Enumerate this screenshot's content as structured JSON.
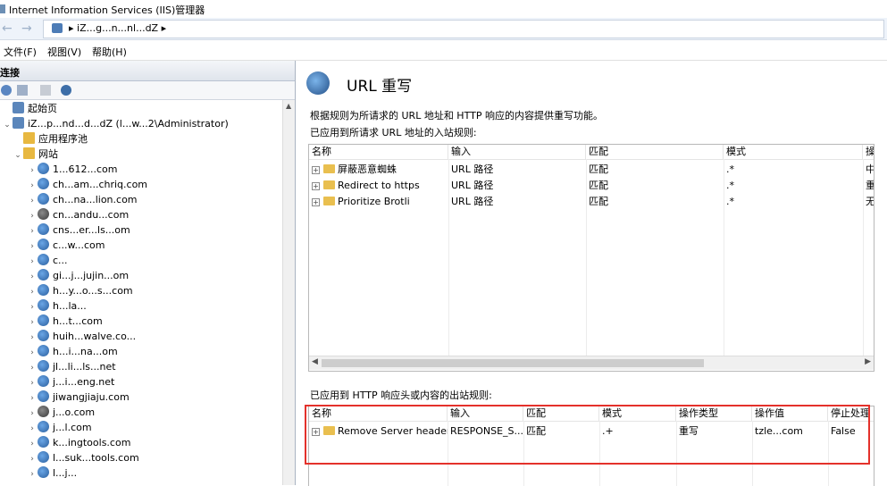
{
  "window": {
    "title": "Internet Information Services (IIS)管理器"
  },
  "address": {
    "server": "iZ...g...n...nl...dZ",
    "arrow": "▸"
  },
  "menu": {
    "file": "文件(F)",
    "view": "视图(V)",
    "help": "帮助(H)"
  },
  "connections": {
    "header": "连接",
    "tree": {
      "start_page": "起始页",
      "server": "iZ...p...nd...d...dZ (l...w...2\\Administrator)",
      "app_pools": "应用程序池",
      "sites_label": "网站",
      "sites": [
        "1...612...com",
        "ch...am...chriq.com",
        "ch...na...lion.com",
        "cn...andu...com",
        "cns...er...ls...om",
        "c...w...com",
        "c...",
        "gi...j...jujin...om",
        "h...y...o...s...com",
        "h...la...",
        "h...t...com",
        "huih...walve.co...",
        "h...i...na...om",
        "jl...li...ls...net",
        "j...i...eng.net",
        "jiwangjiaju.com",
        "j...o.com",
        "j...l.com",
        "k...ingtools.com",
        "l...suk...tools.com",
        "l...j..."
      ]
    }
  },
  "feature": {
    "title": "URL 重写",
    "description": "根据规则为所请求的 URL 地址和 HTTP 响应的内容提供重写功能。",
    "inbound_label": "已应用到所请求 URL 地址的入站规则:",
    "outbound_label": "已应用到 HTTP 响应头或内容的出站规则:"
  },
  "inbound": {
    "columns": [
      "名称",
      "输入",
      "匹配",
      "模式",
      "操"
    ],
    "rows": [
      {
        "name": "屏蔽恶意蜘蛛",
        "input": "URL 路径",
        "match": "匹配",
        "pattern": ".*",
        "action": "中"
      },
      {
        "name": "Redirect to https",
        "input": "URL 路径",
        "match": "匹配",
        "pattern": ".*",
        "action": "重"
      },
      {
        "name": "Prioritize Brotli",
        "input": "URL 路径",
        "match": "匹配",
        "pattern": ".*",
        "action": "无"
      }
    ]
  },
  "outbound": {
    "columns": [
      "名称",
      "输入",
      "匹配",
      "模式",
      "操作类型",
      "操作值",
      "停止处理"
    ],
    "rows": [
      {
        "name": "Remove Server header",
        "input": "RESPONSE_S...",
        "match": "匹配",
        "pattern": ".+",
        "action_type": "重写",
        "action_value": "tzle...com",
        "stop": "False"
      }
    ]
  },
  "colors": {
    "highlight_box": "#e4312b",
    "accent": "#2b5f9e"
  }
}
